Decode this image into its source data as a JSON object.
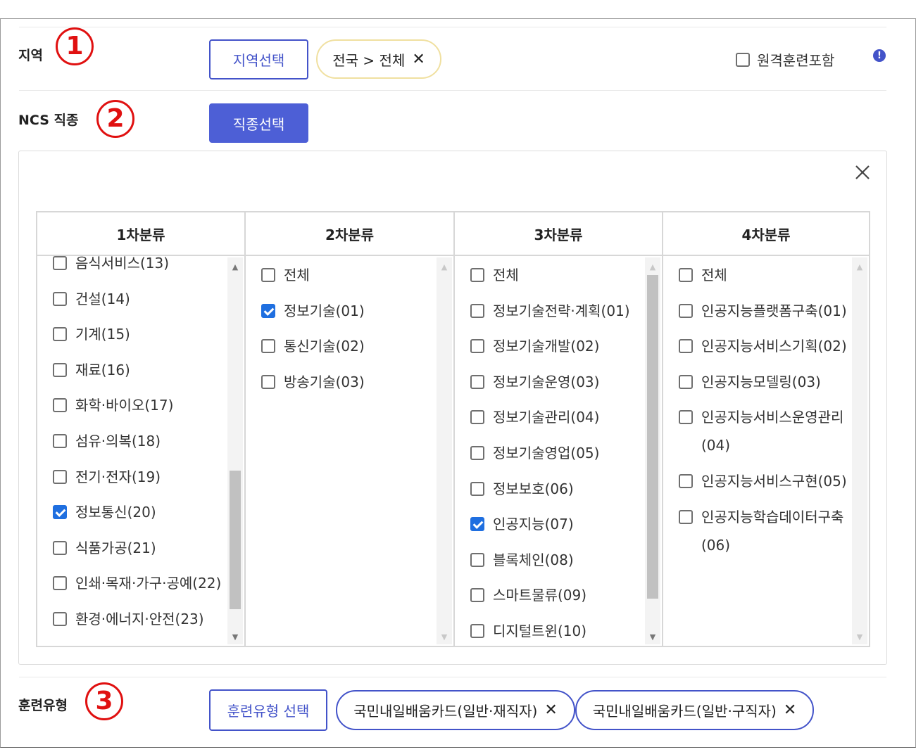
{
  "region": {
    "label": "지역",
    "marker": "1",
    "select_button": "지역선택",
    "chip": "전국 > 전체",
    "remote_checkbox": "원격훈련포함",
    "info": "!"
  },
  "ncs": {
    "label": "NCS 직종",
    "marker": "2",
    "select_button": "직종선택"
  },
  "classification": {
    "columns": [
      {
        "header": "1차분류",
        "items": [
          {
            "label": "음식서비스(13)",
            "checked": false
          },
          {
            "label": "건설(14)",
            "checked": false
          },
          {
            "label": "기계(15)",
            "checked": false
          },
          {
            "label": "재료(16)",
            "checked": false
          },
          {
            "label": "화학·바이오(17)",
            "checked": false
          },
          {
            "label": "섬유·의복(18)",
            "checked": false
          },
          {
            "label": "전기·전자(19)",
            "checked": false
          },
          {
            "label": "정보통신(20)",
            "checked": true
          },
          {
            "label": "식품가공(21)",
            "checked": false
          },
          {
            "label": "인쇄·목재·가구·공예(22)",
            "checked": false
          },
          {
            "label": "환경·에너지·안전(23)",
            "checked": false
          }
        ]
      },
      {
        "header": "2차분류",
        "items": [
          {
            "label": "전체",
            "checked": false
          },
          {
            "label": "정보기술(01)",
            "checked": true
          },
          {
            "label": "통신기술(02)",
            "checked": false
          },
          {
            "label": "방송기술(03)",
            "checked": false
          }
        ]
      },
      {
        "header": "3차분류",
        "items": [
          {
            "label": "전체",
            "checked": false
          },
          {
            "label": "정보기술전략·계획(01)",
            "checked": false
          },
          {
            "label": "정보기술개발(02)",
            "checked": false
          },
          {
            "label": "정보기술운영(03)",
            "checked": false
          },
          {
            "label": "정보기술관리(04)",
            "checked": false
          },
          {
            "label": "정보기술영업(05)",
            "checked": false
          },
          {
            "label": "정보보호(06)",
            "checked": false
          },
          {
            "label": "인공지능(07)",
            "checked": true
          },
          {
            "label": "블록체인(08)",
            "checked": false
          },
          {
            "label": "스마트물류(09)",
            "checked": false
          },
          {
            "label": "디지털트윈(10)",
            "checked": false
          }
        ]
      },
      {
        "header": "4차분류",
        "items": [
          {
            "label": "전체",
            "checked": false
          },
          {
            "label": "인공지능플랫폼구축(01)",
            "checked": false
          },
          {
            "label": "인공지능서비스기획(02)",
            "checked": false
          },
          {
            "label": "인공지능모델링(03)",
            "checked": false
          },
          {
            "label": "인공지능서비스운영관리(04)",
            "checked": false
          },
          {
            "label": "인공지능서비스구현(05)",
            "checked": false
          },
          {
            "label": "인공지능학습데이터구축(06)",
            "checked": false
          }
        ]
      }
    ]
  },
  "training": {
    "label": "훈련유형",
    "marker": "3",
    "select_button": "훈련유형 선택",
    "chips": [
      "국민내일배움카드(일반·재직자)",
      "국민내일배움카드(일반·구직자)"
    ]
  },
  "colors": {
    "accent": "#4353c9",
    "marker": "#e01010",
    "check": "#1f6fe0"
  }
}
